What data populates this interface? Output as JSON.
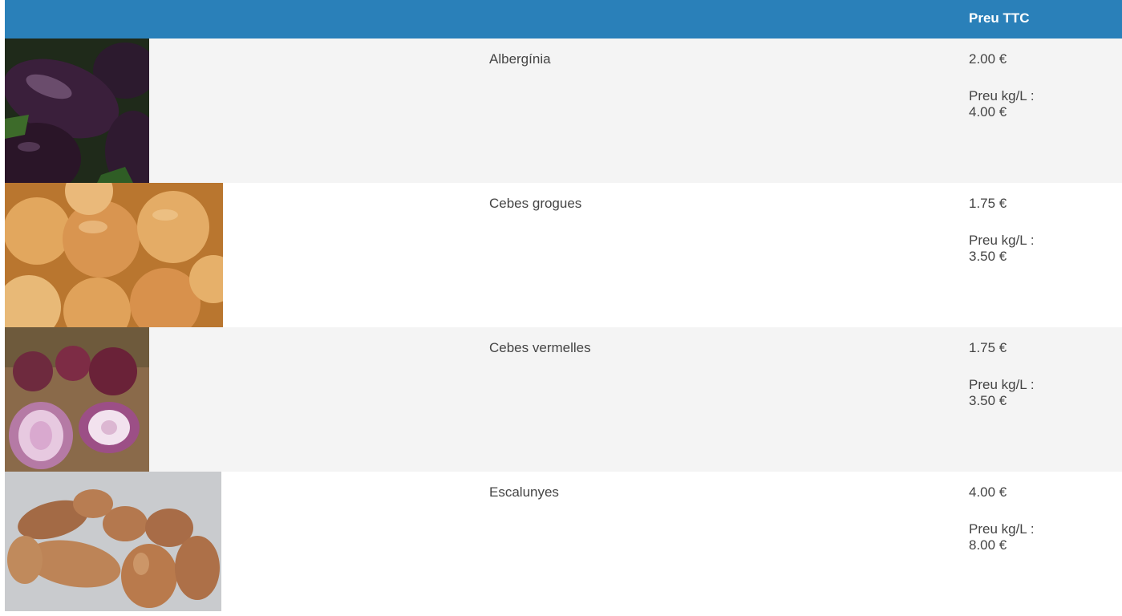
{
  "header": {
    "price_label": "Preu TTC"
  },
  "products": [
    {
      "name": "Albergínia",
      "price": "2.00 €",
      "unit_label": "Preu kg/L :",
      "unit_price": "4.00 €",
      "image_icon": "eggplant-image"
    },
    {
      "name": "Cebes grogues",
      "price": "1.75 €",
      "unit_label": "Preu kg/L :",
      "unit_price": "3.50 €",
      "image_icon": "yellow-onions-image"
    },
    {
      "name": "Cebes vermelles",
      "price": "1.75 €",
      "unit_label": "Preu kg/L :",
      "unit_price": "3.50 €",
      "image_icon": "red-onions-image"
    },
    {
      "name": "Escalunyes",
      "price": "4.00 €",
      "unit_label": "Preu kg/L :",
      "unit_price": "8.00 €",
      "image_icon": "shallots-image"
    }
  ],
  "colors": {
    "header_bg": "#2a80b9",
    "row_alt_bg": "#f4f4f4",
    "text": "#444444"
  }
}
